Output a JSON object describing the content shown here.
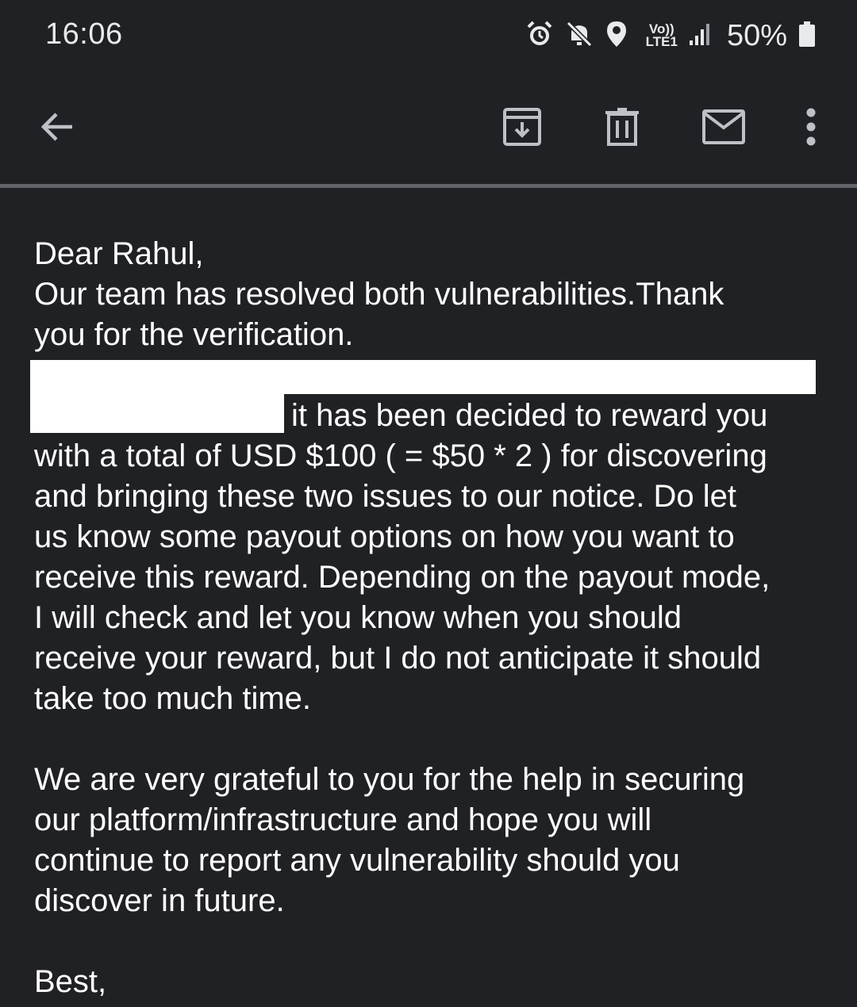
{
  "status_bar": {
    "time": "16:06",
    "battery_percent": "50%",
    "network_label": "Vo))",
    "network_sub": "LTE1",
    "icons": [
      "alarm-icon",
      "mute-icon",
      "location-icon",
      "volte-icon",
      "signal-icon",
      "battery-icon"
    ]
  },
  "toolbar": {
    "icons": [
      "back-arrow-icon",
      "archive-icon",
      "delete-icon",
      "mark-unread-icon",
      "more-options-icon"
    ]
  },
  "email": {
    "greeting": "Dear Rahul,",
    "line1": "Our team has resolved both vulnerabilities.Thank",
    "line2": "you for the verification.",
    "redacted_continuation": "it has been decided to reward you",
    "para1_rest": [
      "with a total of USD $100 ( = $50 * 2 ) for discovering",
      "and bringing these two issues to our notice. Do let",
      "us know some payout options on how you want to",
      "receive this reward. Depending on the payout mode,",
      "I will check and let you know when you should",
      "receive your reward, but I do not anticipate it should",
      "take too much time."
    ],
    "para2": [
      "We are very grateful to you for the help in securing",
      "our platform/infrastructure and hope you will",
      "continue to report any vulnerability should you",
      "discover in future."
    ],
    "signoff": "Best,"
  },
  "colors": {
    "background": "#202124",
    "text": "#ffffff",
    "icon": "#bdc1c6",
    "divider": "#5f6368",
    "redaction": "#ffffff"
  }
}
